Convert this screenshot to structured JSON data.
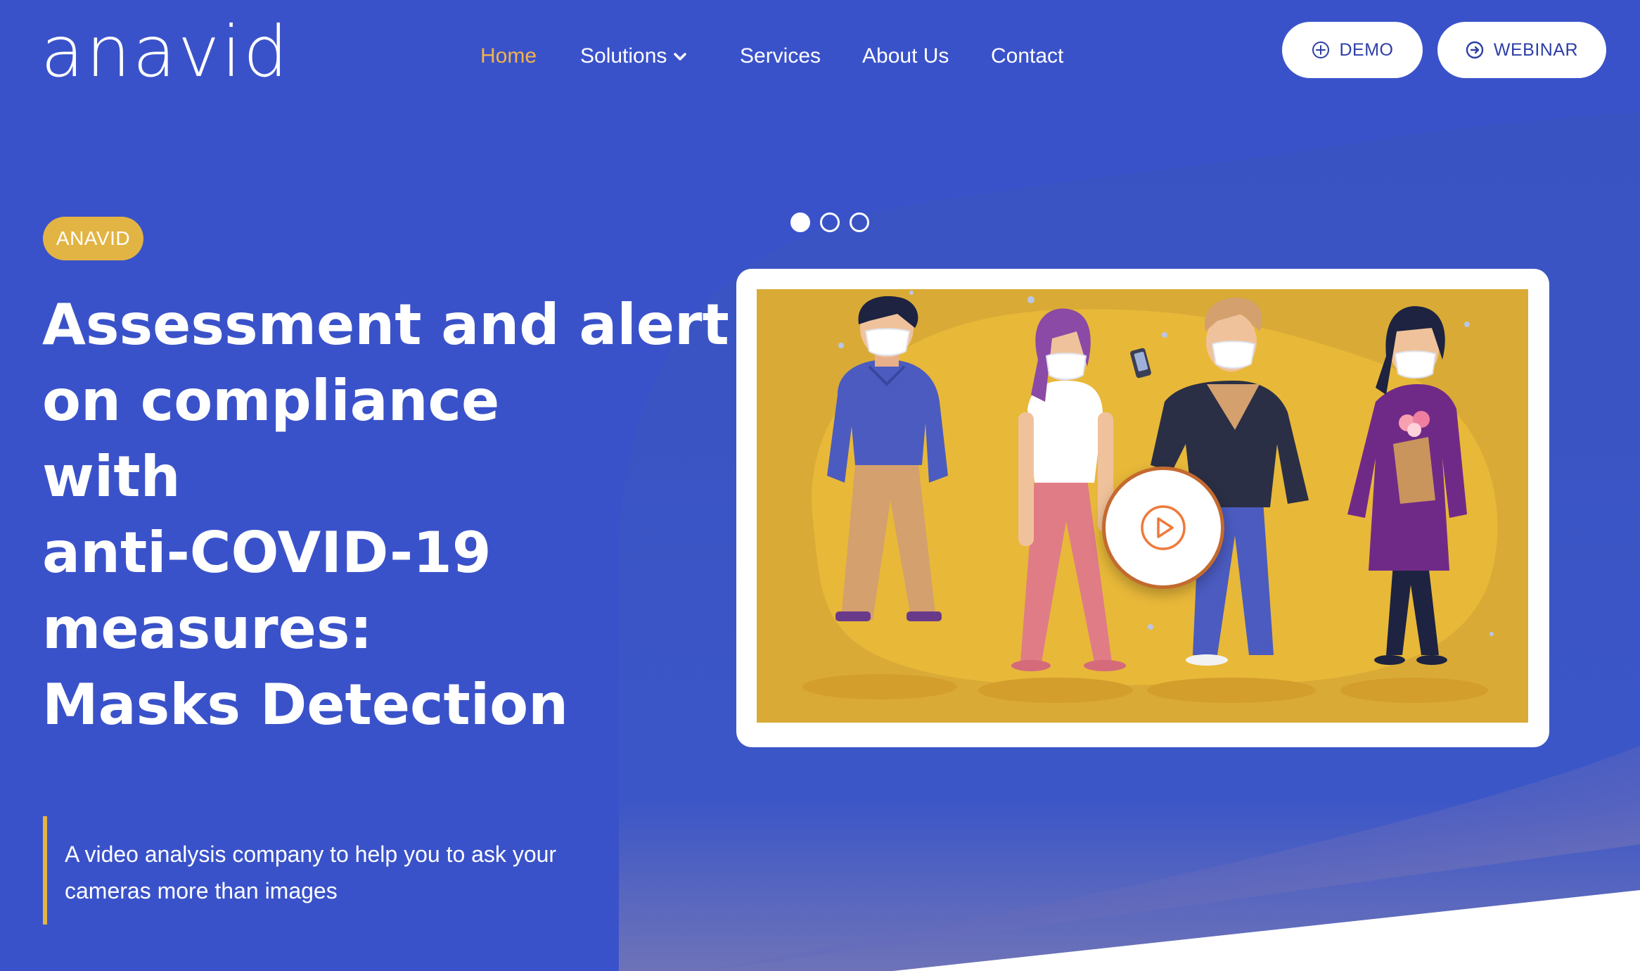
{
  "brand": {
    "logo_text": "anavid"
  },
  "nav": {
    "items": [
      {
        "label": "Home",
        "active": true
      },
      {
        "label": "Solutions",
        "has_dropdown": true
      },
      {
        "label": "Services"
      },
      {
        "label": "About Us"
      },
      {
        "label": "Contact"
      }
    ]
  },
  "header_buttons": {
    "demo": {
      "label": "DEMO",
      "icon": "plus-circle-icon"
    },
    "webinar": {
      "label": "WEBINAR",
      "icon": "arrow-circle-right-icon"
    }
  },
  "hero": {
    "badge": "ANAVID",
    "headline_lines": [
      "Assessment and alert",
      "on compliance",
      "with",
      "anti-COVID-19",
      "measures:",
      "Masks Detection"
    ],
    "tagline": "A video analysis company to help you to ask your cameras more than images"
  },
  "carousel": {
    "slide_count": 3,
    "active_index": 0
  },
  "video": {
    "play_icon": "play-circle-icon",
    "illustration": "four-people-wearing-masks"
  },
  "colors": {
    "background": "#3a52c9",
    "accent": "#e2b443",
    "nav_active": "#f2b44a",
    "button_text": "#2d3fa6",
    "video_bg": "#d9ab36"
  }
}
